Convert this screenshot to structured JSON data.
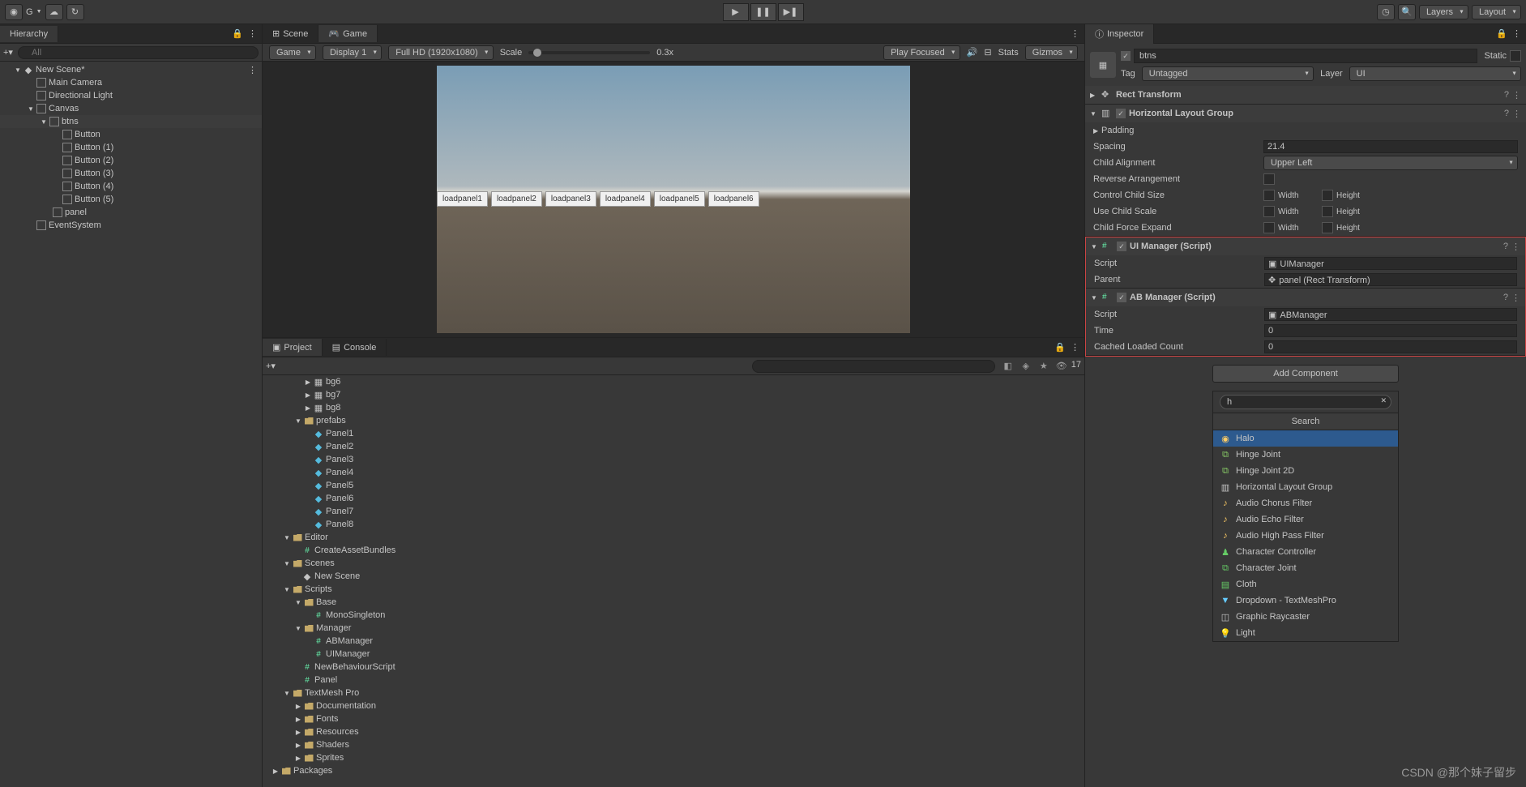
{
  "toolbar": {
    "account": "G",
    "layers": "Layers",
    "layout": "Layout"
  },
  "hierarchy": {
    "title": "Hierarchy",
    "search_placeholder": "All",
    "scene": "New Scene*",
    "items": [
      "Main Camera",
      "Directional Light",
      "Canvas"
    ],
    "btns": "btns",
    "buttons": [
      "Button",
      "Button (1)",
      "Button (2)",
      "Button (3)",
      "Button (4)",
      "Button (5)"
    ],
    "panel": "panel",
    "eventsystem": "EventSystem"
  },
  "scene_tabs": {
    "scene": "Scene",
    "game": "Game"
  },
  "game_toolbar": {
    "game": "Game",
    "display": "Display 1",
    "resolution": "Full HD (1920x1080)",
    "scale_label": "Scale",
    "scale_value": "0.3x",
    "play_focused": "Play Focused",
    "stats": "Stats",
    "gizmos": "Gizmos"
  },
  "load_buttons": [
    "loadpanel1",
    "loadpanel2",
    "loadpanel3",
    "loadpanel4",
    "loadpanel5",
    "loadpanel6"
  ],
  "project": {
    "tab_project": "Project",
    "tab_console": "Console",
    "hidden_count": "17",
    "tree": {
      "bg_items": [
        "bg6",
        "bg7",
        "bg8"
      ],
      "prefabs": "prefabs",
      "panels": [
        "Panel1",
        "Panel2",
        "Panel3",
        "Panel4",
        "Panel5",
        "Panel6",
        "Panel7",
        "Panel8"
      ],
      "editor": "Editor",
      "create_bundles": "CreateAssetBundles",
      "scenes": "Scenes",
      "new_scene": "New Scene",
      "scripts": "Scripts",
      "base": "Base",
      "mono_singleton": "MonoSingleton",
      "manager": "Manager",
      "ab_manager": "ABManager",
      "ui_manager": "UIManager",
      "new_behaviour": "NewBehaviourScript",
      "panel_script": "Panel",
      "textmesh": "TextMesh Pro",
      "documentation": "Documentation",
      "fonts": "Fonts",
      "resources": "Resources",
      "shaders": "Shaders",
      "sprites": "Sprites",
      "packages": "Packages"
    }
  },
  "inspector": {
    "title": "Inspector",
    "name": "btns",
    "static_label": "Static",
    "tag_label": "Tag",
    "tag_value": "Untagged",
    "layer_label": "Layer",
    "layer_value": "UI",
    "rect_transform": "Rect Transform",
    "hlg": {
      "title": "Horizontal Layout Group",
      "padding": "Padding",
      "spacing_label": "Spacing",
      "spacing_value": "21.4",
      "child_alignment_label": "Child Alignment",
      "child_alignment_value": "Upper Left",
      "reverse": "Reverse Arrangement",
      "control_size": "Control Child Size",
      "use_scale": "Use Child Scale",
      "force_expand": "Child Force Expand",
      "width": "Width",
      "height": "Height"
    },
    "ui_manager": {
      "title": "UI Manager (Script)",
      "script_label": "Script",
      "script_value": "UIManager",
      "parent_label": "Parent",
      "parent_value": "panel (Rect Transform)"
    },
    "ab_manager": {
      "title": "AB Manager (Script)",
      "script_label": "Script",
      "script_value": "ABManager",
      "time_label": "Time",
      "time_value": "0",
      "cached_label": "Cached Loaded Count",
      "cached_value": "0"
    },
    "add_component": "Add Component",
    "search_value": "h",
    "search_title": "Search",
    "search_results": [
      "Halo",
      "Hinge Joint",
      "Hinge Joint 2D",
      "Horizontal Layout Group",
      "Audio Chorus Filter",
      "Audio Echo Filter",
      "Audio High Pass Filter",
      "Character Controller",
      "Character Joint",
      "Cloth",
      "Dropdown - TextMeshPro",
      "Graphic Raycaster",
      "Light"
    ]
  },
  "watermark": "CSDN @那个妹子留步"
}
